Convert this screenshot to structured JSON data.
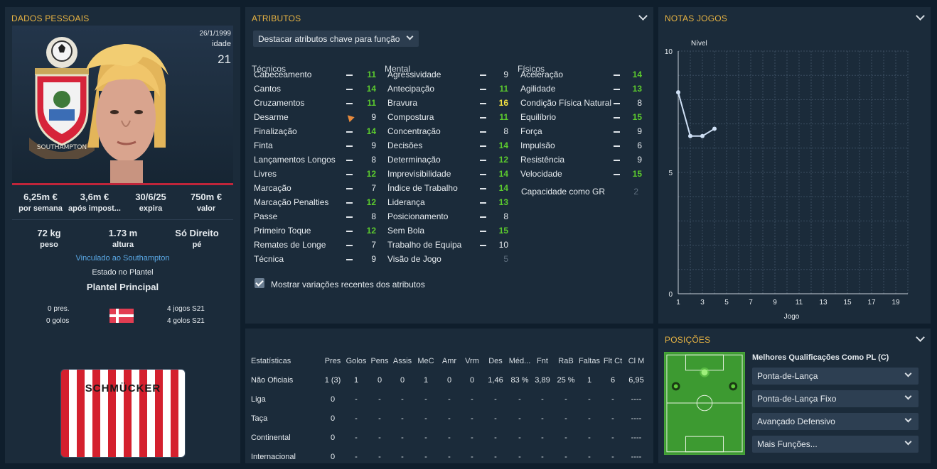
{
  "personal": {
    "title": "DADOS PESSOAIS",
    "dob": "26/1/1999",
    "age_label": "idade",
    "age": "21",
    "stats1": [
      {
        "v": "6,25m €",
        "l": "por semana"
      },
      {
        "v": "3,6m €",
        "l": "após impost..."
      },
      {
        "v": "30/6/25",
        "l": "expira"
      },
      {
        "v": "750m €",
        "l": "valor"
      }
    ],
    "stats2": [
      {
        "v": "72 kg",
        "l": "peso"
      },
      {
        "v": "1.73 m",
        "l": "altura"
      },
      {
        "v": "Só Direito",
        "l": "pé"
      }
    ],
    "linked": "Vinculado ao Southampton",
    "squad_label": "Estado no Plantel",
    "squad_value": "Plantel Principal",
    "caps": "0 pres.",
    "goals": "0 golos",
    "u21_caps": "4 jogos S21",
    "u21_goals": "4 golos S21",
    "kit_name": "SCHMÜCKER",
    "club_crest_text": "SOUTHAMPTON"
  },
  "attributes": {
    "title": "ATRIBUTOS",
    "highlight_dropdown": "Destacar atributos chave para função",
    "col_tech": "Técnicos",
    "col_mental": "Mental",
    "col_phys": "Físicos",
    "technical": [
      {
        "n": "Cabeceamento",
        "v": "11",
        "c": "g"
      },
      {
        "n": "Cantos",
        "v": "14",
        "c": "g"
      },
      {
        "n": "Cruzamentos",
        "v": "11",
        "c": "g"
      },
      {
        "n": "Desarme",
        "v": "9",
        "c": "w",
        "arrow": true
      },
      {
        "n": "Finalização",
        "v": "14",
        "c": "g"
      },
      {
        "n": "Finta",
        "v": "9",
        "c": "w"
      },
      {
        "n": "Lançamentos Longos",
        "v": "8",
        "c": "w"
      },
      {
        "n": "Livres",
        "v": "12",
        "c": "g"
      },
      {
        "n": "Marcação",
        "v": "7",
        "c": "w"
      },
      {
        "n": "Marcação Penalties",
        "v": "12",
        "c": "g"
      },
      {
        "n": "Passe",
        "v": "8",
        "c": "w"
      },
      {
        "n": "Primeiro Toque",
        "v": "12",
        "c": "g"
      },
      {
        "n": "Remates de Longe",
        "v": "7",
        "c": "w"
      },
      {
        "n": "Técnica",
        "v": "9",
        "c": "w"
      }
    ],
    "mental": [
      {
        "n": "Agressividade",
        "v": "9",
        "c": "w"
      },
      {
        "n": "Antecipação",
        "v": "11",
        "c": "g"
      },
      {
        "n": "Bravura",
        "v": "16",
        "c": "y"
      },
      {
        "n": "Compostura",
        "v": "11",
        "c": "g"
      },
      {
        "n": "Concentração",
        "v": "8",
        "c": "w"
      },
      {
        "n": "Decisões",
        "v": "14",
        "c": "g"
      },
      {
        "n": "Determinação",
        "v": "12",
        "c": "g"
      },
      {
        "n": "Imprevisibilidade",
        "v": "14",
        "c": "g"
      },
      {
        "n": "Índice de Trabalho",
        "v": "14",
        "c": "g"
      },
      {
        "n": "Liderança",
        "v": "13",
        "c": "g"
      },
      {
        "n": "Posicionamento",
        "v": "8",
        "c": "w"
      },
      {
        "n": "Sem Bola",
        "v": "15",
        "c": "g"
      },
      {
        "n": "Trabalho de Equipa",
        "v": "10",
        "c": "w"
      },
      {
        "n": "Visão de Jogo",
        "v": "5",
        "c": "gr",
        "nodash": true
      }
    ],
    "physical": [
      {
        "n": "Aceleração",
        "v": "14",
        "c": "g"
      },
      {
        "n": "Agilidade",
        "v": "13",
        "c": "g"
      },
      {
        "n": "Condição Física Natural",
        "v": "8",
        "c": "w"
      },
      {
        "n": "Equilíbrio",
        "v": "15",
        "c": "g"
      },
      {
        "n": "Força",
        "v": "9",
        "c": "w"
      },
      {
        "n": "Impulsão",
        "v": "6",
        "c": "w"
      },
      {
        "n": "Resistência",
        "v": "9",
        "c": "w"
      },
      {
        "n": "Velocidade",
        "v": "15",
        "c": "g"
      }
    ],
    "gk_label": "Capacidade como GR",
    "gk_value": "2",
    "show_changes": "Mostrar variações recentes dos atributos"
  },
  "stats": {
    "header_label": "Estatísticas",
    "columns": [
      "Pres",
      "Golos",
      "Pens",
      "Assis",
      "MeC",
      "Amr",
      "Vrm",
      "Des",
      "Méd...",
      "Fnt",
      "RaB",
      "Faltas",
      "Flt Ct",
      "Cl M"
    ],
    "rows": [
      {
        "label": "Não Oficiais",
        "cells": [
          "1 (3)",
          "1",
          "0",
          "0",
          "1",
          "0",
          "0",
          "1,46",
          "83 %",
          "3,89",
          "25 %",
          "1",
          "6",
          "6,95"
        ]
      },
      {
        "label": "Liga",
        "cells": [
          "0",
          "-",
          "-",
          "-",
          "-",
          "-",
          "-",
          "-",
          "-",
          "-",
          "-",
          "-",
          "-",
          "----"
        ]
      },
      {
        "label": "Taça",
        "cells": [
          "0",
          "-",
          "-",
          "-",
          "-",
          "-",
          "-",
          "-",
          "-",
          "-",
          "-",
          "-",
          "-",
          "----"
        ]
      },
      {
        "label": "Continental",
        "cells": [
          "0",
          "-",
          "-",
          "-",
          "-",
          "-",
          "-",
          "-",
          "-",
          "-",
          "-",
          "-",
          "-",
          "----"
        ]
      },
      {
        "label": "Internacional",
        "cells": [
          "0",
          "-",
          "-",
          "-",
          "-",
          "-",
          "-",
          "-",
          "-",
          "-",
          "-",
          "-",
          "-",
          "----"
        ]
      }
    ]
  },
  "chart_panel": {
    "title": "NOTAS JOGOS"
  },
  "chart_data": {
    "type": "line",
    "ylabel": "Nível",
    "xlabel": "Jogo",
    "ylim": [
      0,
      10
    ],
    "yticks": [
      0,
      5,
      10
    ],
    "xlim": [
      1,
      20
    ],
    "xticks": [
      1,
      3,
      5,
      7,
      9,
      11,
      13,
      15,
      17,
      19
    ],
    "series": [
      {
        "x": [
          1,
          2,
          3,
          4
        ],
        "y": [
          8.3,
          6.5,
          6.5,
          6.8
        ]
      }
    ],
    "grid": true,
    "line_color": "#cfe0f5"
  },
  "positions": {
    "title": "POSIÇÕES",
    "best_label": "Melhores Qualificações Como PL (C)",
    "roles": [
      "Ponta-de-Lança",
      "Ponta-de-Lança Fixo",
      "Avançado Defensivo",
      "Mais Funções..."
    ]
  }
}
